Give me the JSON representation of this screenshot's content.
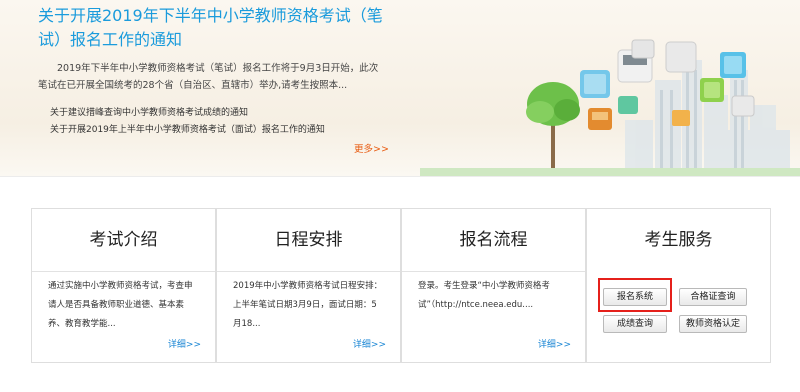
{
  "banner": {
    "title": "关于开展2019年下半年中小学教师资格考试（笔试）报名工作的通知",
    "summary": "2019年下半年中小学教师资格考试（笔试）报名工作将于9月3日开始，此次笔试在已开展全国统考的28个省（自治区、直辖市）举办,请考生按照本...",
    "news": [
      "关于建议措峰查询中小学教师资格考试成绩的通知",
      "关于开展2019年上半年中小学教师资格考试（面试）报名工作的通知"
    ],
    "more": "更多>>"
  },
  "cards": [
    {
      "title": "考试介绍",
      "text": "通过实施中小学教师资格考试，考查申请人是否具备教师职业道德、基本素养、教育教学能...",
      "more": "详细>>"
    },
    {
      "title": "日程安排",
      "text": "2019年中小学教师资格考试日程安排：上半年笔试日期3月9日，面试日期：5月18...",
      "more": "详细>>"
    },
    {
      "title": "报名流程",
      "text": "登录。考生登录“中小学教师资格考试”（http://ntce.neea.edu....",
      "more": "详细>>"
    }
  ],
  "services": {
    "title": "考生服务",
    "buttons": [
      "报名系统",
      "合格证查询",
      "成绩查询",
      "教师资格认定"
    ]
  },
  "colors": {
    "accent": "#1a9bdc",
    "more": "#e85c12",
    "highlight": "#e5201b"
  }
}
